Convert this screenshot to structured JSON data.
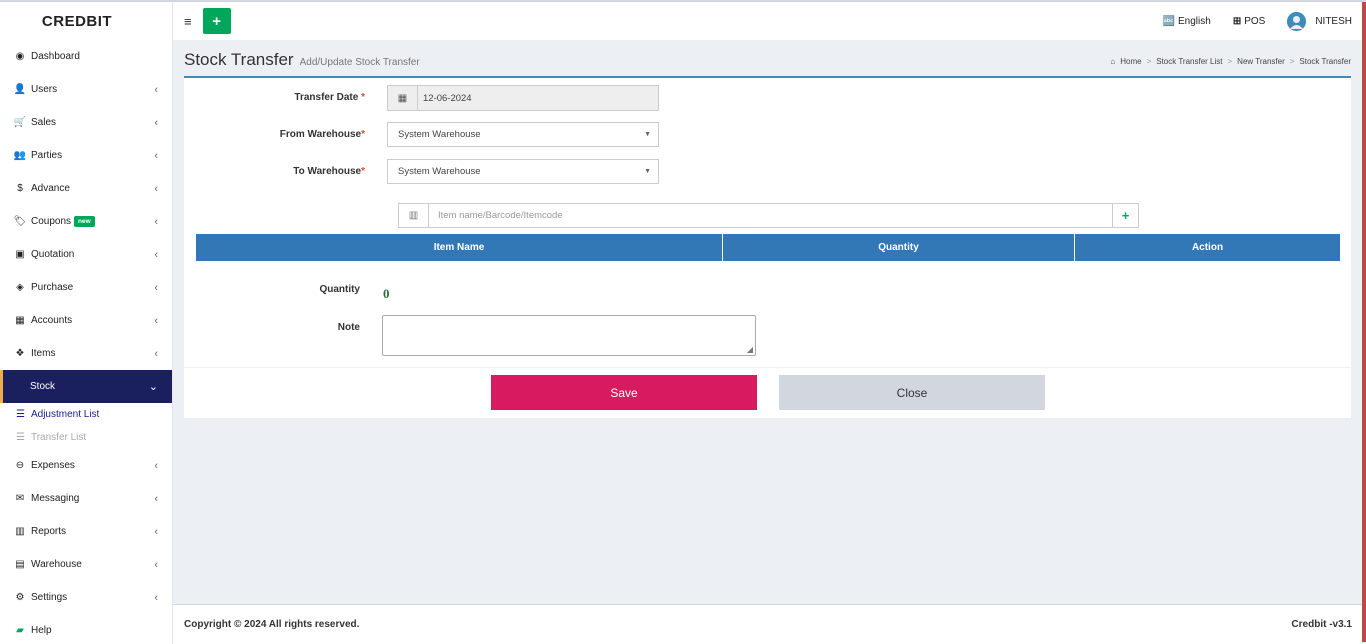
{
  "app": {
    "logo": "CREDBIT"
  },
  "sidebar": {
    "items": [
      {
        "label": "Dashboard",
        "icon": "dashboard-icon"
      },
      {
        "label": "Users",
        "icon": "user-plus-icon"
      },
      {
        "label": "Sales",
        "icon": "cart-icon"
      },
      {
        "label": "Parties",
        "icon": "users-icon"
      },
      {
        "label": "Advance",
        "icon": "dollar-icon"
      },
      {
        "label": "Coupons",
        "icon": "tags-icon",
        "badge": "new"
      },
      {
        "label": "Quotation",
        "icon": "calendar-plus-icon"
      },
      {
        "label": "Purchase",
        "icon": "cube-icon"
      },
      {
        "label": "Accounts",
        "icon": "grid-icon"
      },
      {
        "label": "Items",
        "icon": "cubes-icon"
      },
      {
        "label": "Stock",
        "icon": "",
        "active": true
      },
      {
        "label": "Expenses",
        "icon": "minus-circle-icon"
      },
      {
        "label": "Messaging",
        "icon": "envelope-icon"
      },
      {
        "label": "Reports",
        "icon": "bar-chart-icon"
      },
      {
        "label": "Warehouse",
        "icon": "building-icon"
      },
      {
        "label": "Settings",
        "icon": "cogs-icon"
      },
      {
        "label": "Help",
        "icon": "book-icon"
      }
    ],
    "stock_sub": [
      {
        "label": "Adjustment List",
        "icon": "list-icon"
      },
      {
        "label": "Transfer List",
        "icon": "list-icon"
      }
    ]
  },
  "header": {
    "language": "English",
    "pos": "POS",
    "user": "NITESH"
  },
  "page": {
    "title": "Stock Transfer",
    "subtitle": "Add/Update Stock Transfer",
    "breadcrumb": [
      "Home",
      "Stock Transfer List",
      "New Transfer",
      "Stock Transfer"
    ]
  },
  "form": {
    "transfer_date_label": "Transfer Date",
    "transfer_date_value": "12-06-2024",
    "from_label": "From Warehouse",
    "from_value": "System Warehouse",
    "to_label": "To Warehouse",
    "to_value": "System Warehouse",
    "required_mark": "*",
    "search_placeholder": "Item name/Barcode/Itemcode",
    "table_headers": [
      "Item Name",
      "Quantity",
      "Action"
    ],
    "quantity_label": "Quantity",
    "quantity_value": "0",
    "note_label": "Note",
    "save_label": "Save",
    "close_label": "Close"
  },
  "footer": {
    "copyright": "Copyright © 2024 All rights reserved.",
    "version": "Credbit -v3.1"
  },
  "colors": {
    "sidebar_active": "#1a1f5e",
    "primary": "#3278b7",
    "save": "#d81b60",
    "add": "#00a65a"
  }
}
